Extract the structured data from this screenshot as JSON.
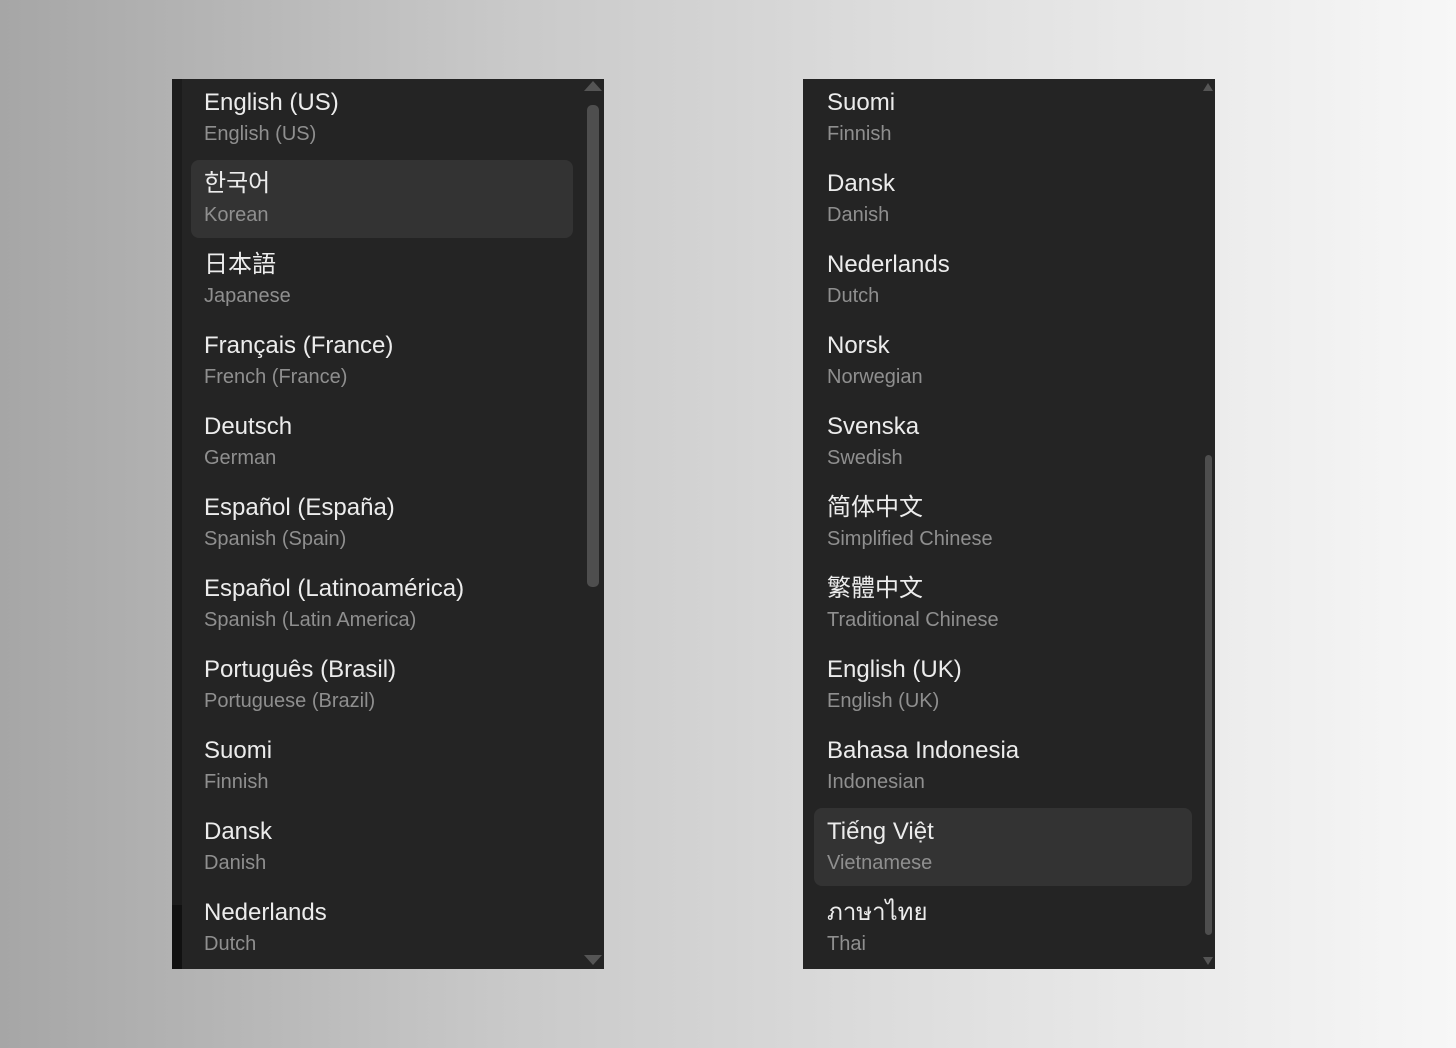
{
  "panels": {
    "left": {
      "items": [
        {
          "native": "English (US)",
          "english": "English (US)"
        },
        {
          "native": "한국어",
          "english": "Korean",
          "selected": true
        },
        {
          "native": "日本語",
          "english": "Japanese"
        },
        {
          "native": "Français (France)",
          "english": "French (France)"
        },
        {
          "native": "Deutsch",
          "english": "German"
        },
        {
          "native": "Español (España)",
          "english": "Spanish (Spain)"
        },
        {
          "native": "Español (Latinoamérica)",
          "english": "Spanish (Latin America)"
        },
        {
          "native": "Português (Brasil)",
          "english": "Portuguese (Brazil)"
        },
        {
          "native": "Suomi",
          "english": "Finnish"
        },
        {
          "native": "Dansk",
          "english": "Danish"
        },
        {
          "native": "Nederlands",
          "english": "Dutch"
        }
      ]
    },
    "right": {
      "items": [
        {
          "native": "Suomi",
          "english": "Finnish"
        },
        {
          "native": "Dansk",
          "english": "Danish"
        },
        {
          "native": "Nederlands",
          "english": "Dutch"
        },
        {
          "native": "Norsk",
          "english": "Norwegian"
        },
        {
          "native": "Svenska",
          "english": "Swedish"
        },
        {
          "native": "简体中文",
          "english": "Simplified Chinese"
        },
        {
          "native": "繁體中文",
          "english": "Traditional Chinese"
        },
        {
          "native": "English (UK)",
          "english": "English (UK)"
        },
        {
          "native": "Bahasa Indonesia",
          "english": "Indonesian"
        },
        {
          "native": "Tiếng Việt",
          "english": "Vietnamese",
          "selected": true
        },
        {
          "native": "ภาษาไทย",
          "english": "Thai"
        }
      ]
    }
  },
  "colors": {
    "panel_bg": "#242424",
    "selected_bg": "#333333",
    "native_text": "#ececec",
    "english_text": "#8f8f8f"
  },
  "icons": [
    "scroll-up-arrow-icon",
    "scroll-down-arrow-icon"
  ]
}
